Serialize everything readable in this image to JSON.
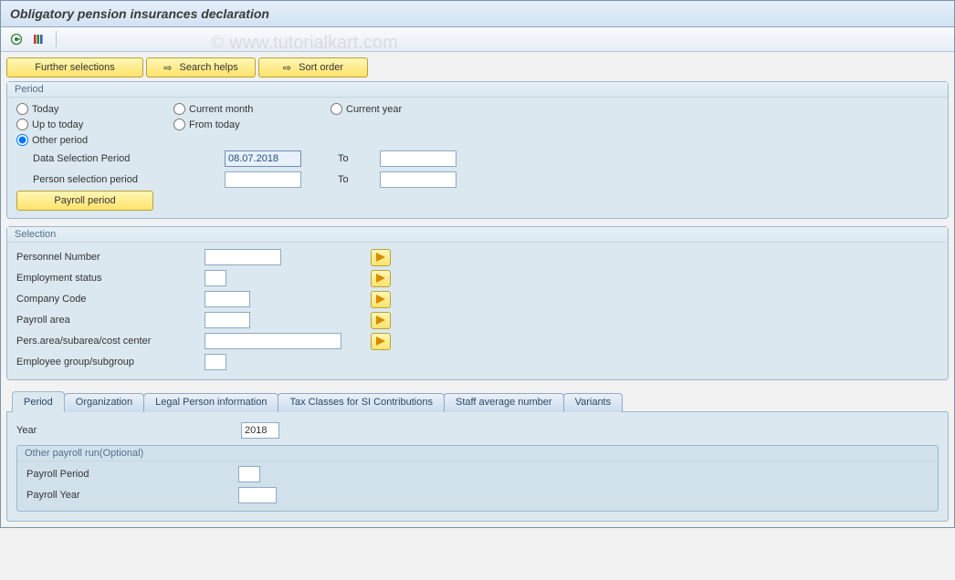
{
  "header": {
    "title": "Obligatory pension insurances declaration"
  },
  "watermark": "© www.tutorialkart.com",
  "actions": {
    "further": "Further selections",
    "search": "Search helps",
    "sort": "Sort order"
  },
  "period_group": {
    "title": "Period",
    "radios": {
      "today": "Today",
      "current_month": "Current month",
      "current_year": "Current year",
      "up_to_today": "Up to today",
      "from_today": "From today",
      "other_period": "Other period"
    },
    "data_sel_label": "Data Selection Period",
    "data_sel_value": "08.07.2018",
    "to_label": "To",
    "person_sel_label": "Person selection period",
    "payroll_period_btn": "Payroll period"
  },
  "selection_group": {
    "title": "Selection",
    "rows": [
      {
        "label": "Personnel Number"
      },
      {
        "label": "Employment status"
      },
      {
        "label": "Company Code"
      },
      {
        "label": "Payroll area"
      },
      {
        "label": "Pers.area/subarea/cost center"
      },
      {
        "label": "Employee group/subgroup"
      }
    ]
  },
  "tabs": {
    "items": [
      {
        "label": "Period"
      },
      {
        "label": "Organization"
      },
      {
        "label": "Legal Person information"
      },
      {
        "label": "Tax Classes for SI Contributions"
      },
      {
        "label": "Staff average number"
      },
      {
        "label": "Variants"
      }
    ],
    "active": 0
  },
  "tab_period": {
    "year_label": "Year",
    "year_value": "2018",
    "inner_title": "Other payroll run(Optional)",
    "payroll_period": "Payroll Period",
    "payroll_year": "Payroll Year"
  }
}
